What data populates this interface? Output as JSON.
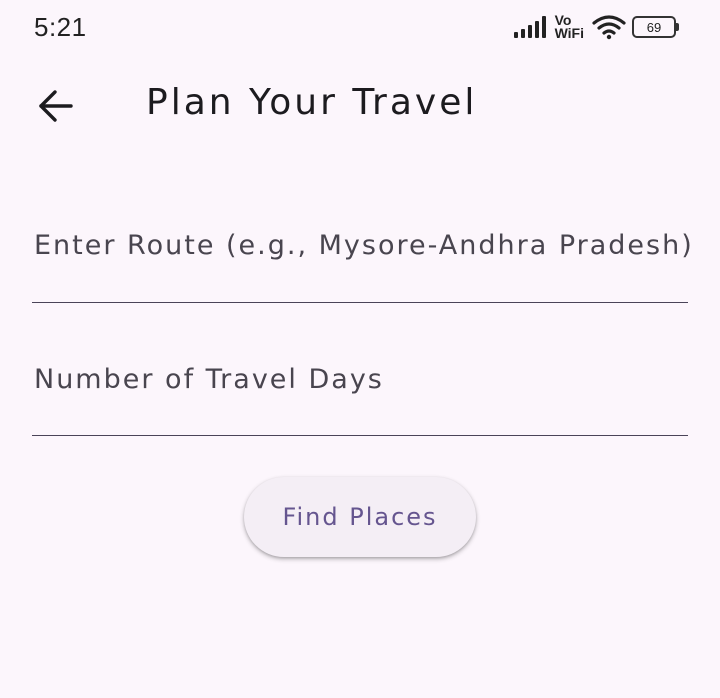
{
  "status_bar": {
    "time": "5:21",
    "vowifi_top": "Vo",
    "vowifi_bottom": "WiFi",
    "battery_level": "69",
    "icons": [
      "signal-icon",
      "vowifi-icon",
      "wifi-icon",
      "battery-icon"
    ]
  },
  "app_bar": {
    "back_icon": "arrow-back-icon",
    "title": "Plan Your Travel"
  },
  "form": {
    "route_label": "Enter Route (e.g., Mysore-Andhra Pradesh)",
    "route_value": "",
    "days_label": "Number of Travel Days",
    "days_value": "",
    "submit_label": "Find Places"
  },
  "colors": {
    "background": "#fcf6fc",
    "button_background": "#f4eef5",
    "button_text": "#65558f",
    "field_underline": "#4a4458",
    "label_text": "#49454f"
  }
}
